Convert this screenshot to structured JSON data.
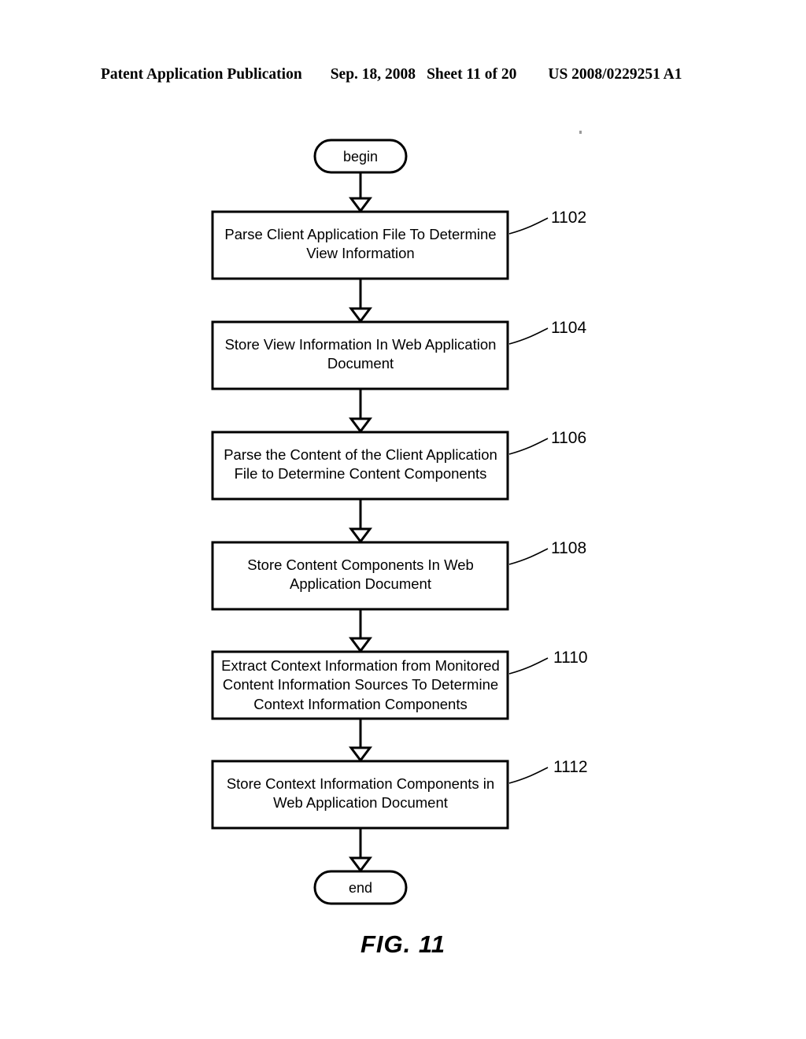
{
  "header": {
    "publication": "Patent Application Publication",
    "date": "Sep. 18, 2008",
    "sheet": "Sheet 11 of 20",
    "patent_number": "US 2008/0229251 A1"
  },
  "figure": {
    "caption": "FIG. 11",
    "type": "flowchart",
    "line_color": "#000000",
    "fill_color": "#ffffff"
  },
  "flowchart": {
    "start": {
      "label": "begin",
      "shape": "terminator"
    },
    "end": {
      "label": "end",
      "shape": "terminator"
    },
    "steps": [
      {
        "ref": "1102",
        "shape": "process",
        "label": "Parse Client Application File To Determine\nView Information"
      },
      {
        "ref": "1104",
        "shape": "process",
        "label": "Store View Information In Web Application\nDocument"
      },
      {
        "ref": "1106",
        "shape": "process",
        "label": "Parse the Content of the Client Application\nFile to Determine Content Components"
      },
      {
        "ref": "1108",
        "shape": "process",
        "label": "Store Content Components In Web\nApplication Document"
      },
      {
        "ref": "1110",
        "shape": "process",
        "label": "Extract Context Information from Monitored\nContent Information Sources To Determine\nContext Information Components"
      },
      {
        "ref": "1112",
        "shape": "process",
        "label": "Store Context Information Components in\nWeb Application Document"
      }
    ]
  }
}
